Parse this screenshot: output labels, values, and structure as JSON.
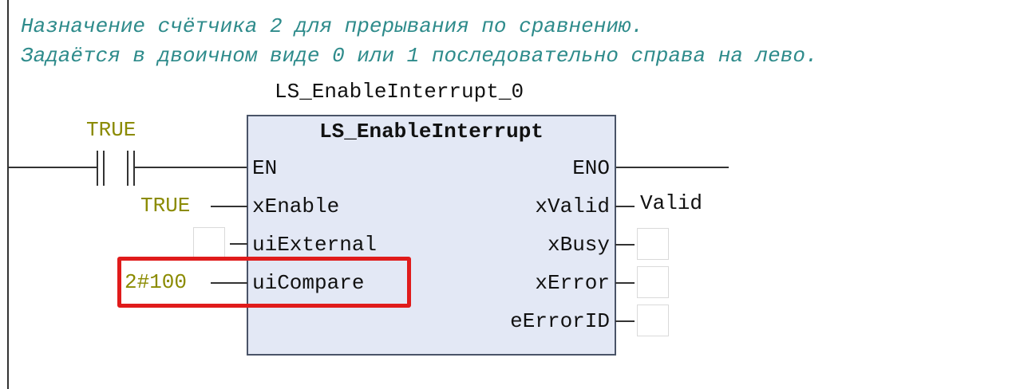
{
  "comment": {
    "line1": "Назначение счётчика 2 для прерывания по сравнению.",
    "line2": "Задаётся в двоичном виде 0 или 1 последовательно справа на лево."
  },
  "block": {
    "instance_name": "LS_EnableInterrupt_0",
    "type_name": "LS_EnableInterrupt",
    "inputs": [
      "EN",
      "xEnable",
      "uiExternal",
      "uiCompare"
    ],
    "outputs": [
      "ENO",
      "xValid",
      "xBusy",
      "xError",
      "eErrorID"
    ]
  },
  "contact": {
    "label": "TRUE"
  },
  "input_values": {
    "xEnable": "TRUE",
    "uiExternal": "",
    "uiCompare": "2#100"
  },
  "output_values": {
    "xValid": "Valid",
    "xBusy": "",
    "xError": "",
    "eErrorID": ""
  },
  "colors": {
    "comment": "#2e8b8b",
    "constant": "#8b8b00",
    "block_fill": "#e3e8f5",
    "highlight": "#e01b1b"
  }
}
